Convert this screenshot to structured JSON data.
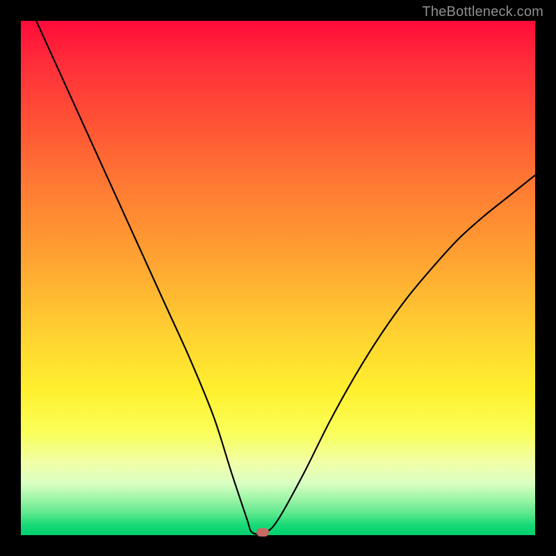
{
  "watermark": "TheBottleneck.com",
  "chart_data": {
    "type": "line",
    "title": "",
    "xlabel": "",
    "ylabel": "",
    "xlim": [
      0,
      100
    ],
    "ylim": [
      0,
      100
    ],
    "series": [
      {
        "name": "bottleneck-curve",
        "x": [
          3,
          8,
          13,
          18,
          23,
          28,
          33,
          37.5,
          41,
          44,
          45,
          47.5,
          50,
          55,
          60,
          65,
          70,
          75,
          80,
          85,
          90,
          95,
          100
        ],
        "values": [
          100,
          89,
          78,
          67,
          56,
          45,
          34,
          23,
          12,
          3,
          0.5,
          0.5,
          3,
          12,
          22,
          31,
          39,
          46,
          52,
          57.5,
          62,
          66,
          70
        ]
      }
    ],
    "marker": {
      "x": 47,
      "y": 0.5,
      "name": "optimal-point"
    },
    "grid": false,
    "legend": false
  },
  "colors": {
    "curve": "#000000",
    "marker": "#c76a62",
    "gradient_top": "#ff0b3a",
    "gradient_bottom": "#00d06e",
    "frame": "#000000"
  }
}
